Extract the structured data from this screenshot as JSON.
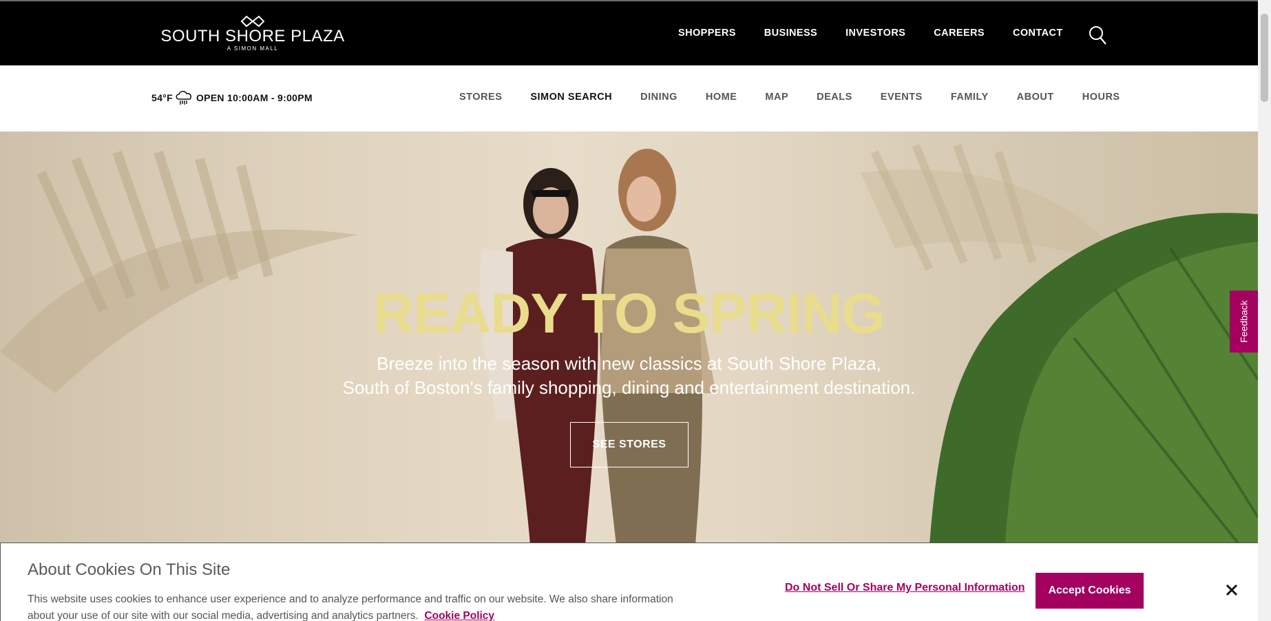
{
  "brand": {
    "name": "SOUTH SHORE PLAZA",
    "tagline": "A SIMON MALL"
  },
  "top_nav": [
    "SHOPPERS",
    "BUSINESS",
    "INVESTORS",
    "CAREERS",
    "CONTACT"
  ],
  "top_nav_icons": {
    "search": "search-icon"
  },
  "info": {
    "temperature": "54°F",
    "weather_icon": "cloud-rain-icon",
    "hours": "OPEN 10:00AM - 9:00PM"
  },
  "sub_nav": [
    "STORES",
    "SIMON SEARCH",
    "DINING",
    "HOME",
    "MAP",
    "DEALS",
    "EVENTS",
    "FAMILY",
    "ABOUT",
    "HOURS"
  ],
  "sub_nav_active": "SIMON SEARCH",
  "hero": {
    "title": "READY TO SPRING",
    "line1": "Breeze into the season with new classics at South Shore Plaza,",
    "line2": "South of Boston's family shopping, dining and entertainment destination.",
    "button": "SEE STORES"
  },
  "feedback_tab": "Feedback",
  "cookie": {
    "title": "About Cookies On This Site",
    "text": "This website uses cookies to enhance user experience and to analyze performance and traffic on our website. We also share information about your use of our site with our social media, advertising and analytics partners.",
    "policy_link": "Cookie Policy",
    "dns_link": "Do Not Sell Or Share My Personal Information",
    "accept": "Accept Cookies",
    "close_icon": "close-icon"
  },
  "colors": {
    "brand_accent": "#a3005f",
    "hero_title": "#e9dc8d",
    "topbar": "#000000"
  }
}
